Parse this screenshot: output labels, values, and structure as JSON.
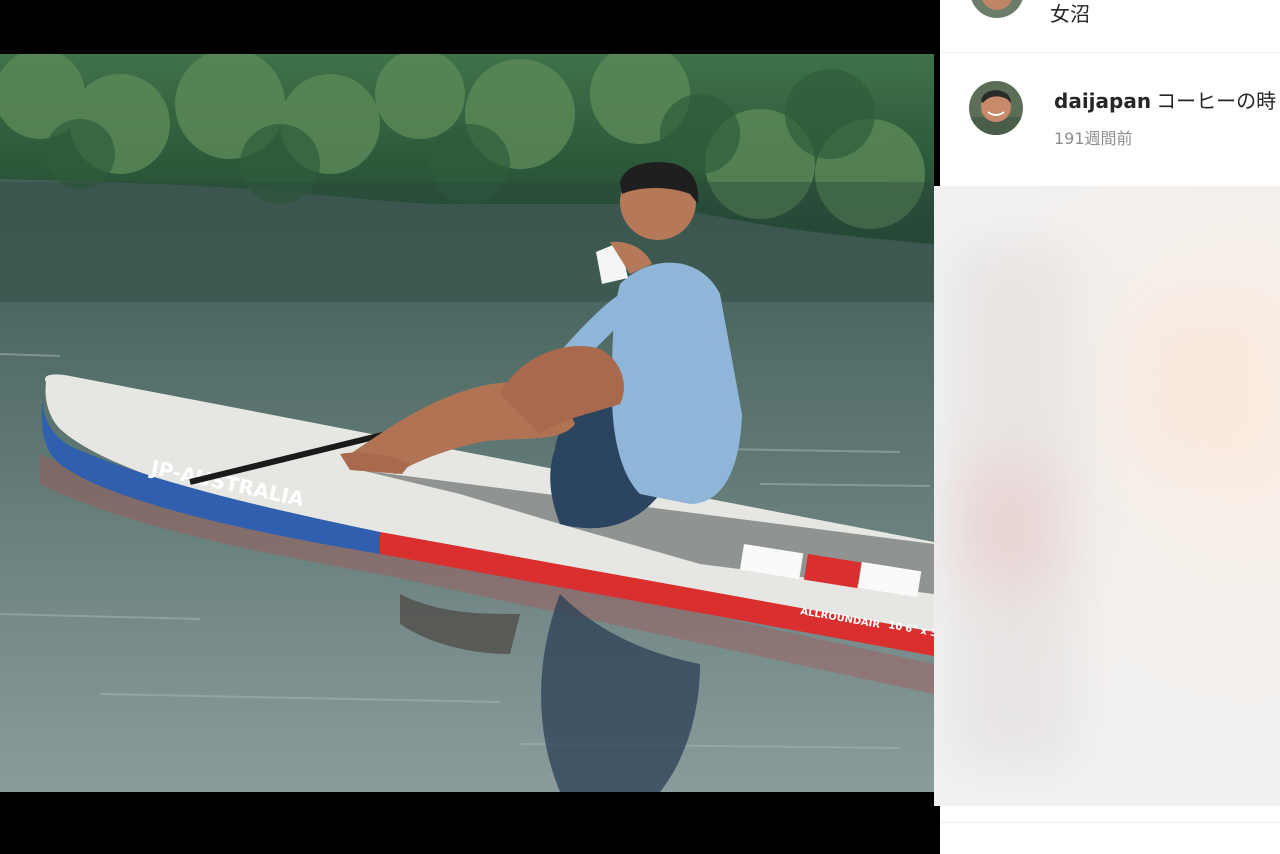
{
  "post": {
    "photo_alt": "SUP photo"
  },
  "comments": [
    {
      "username": "",
      "text": "女沼",
      "time": ""
    },
    {
      "username": "daijapan",
      "text": "コーヒーの時",
      "time": "191週間前"
    }
  ],
  "board": {
    "brand": "JP-AUSTRALIA",
    "model": "ALLROUNDAIR",
    "size": "10'6\" x 3"
  }
}
